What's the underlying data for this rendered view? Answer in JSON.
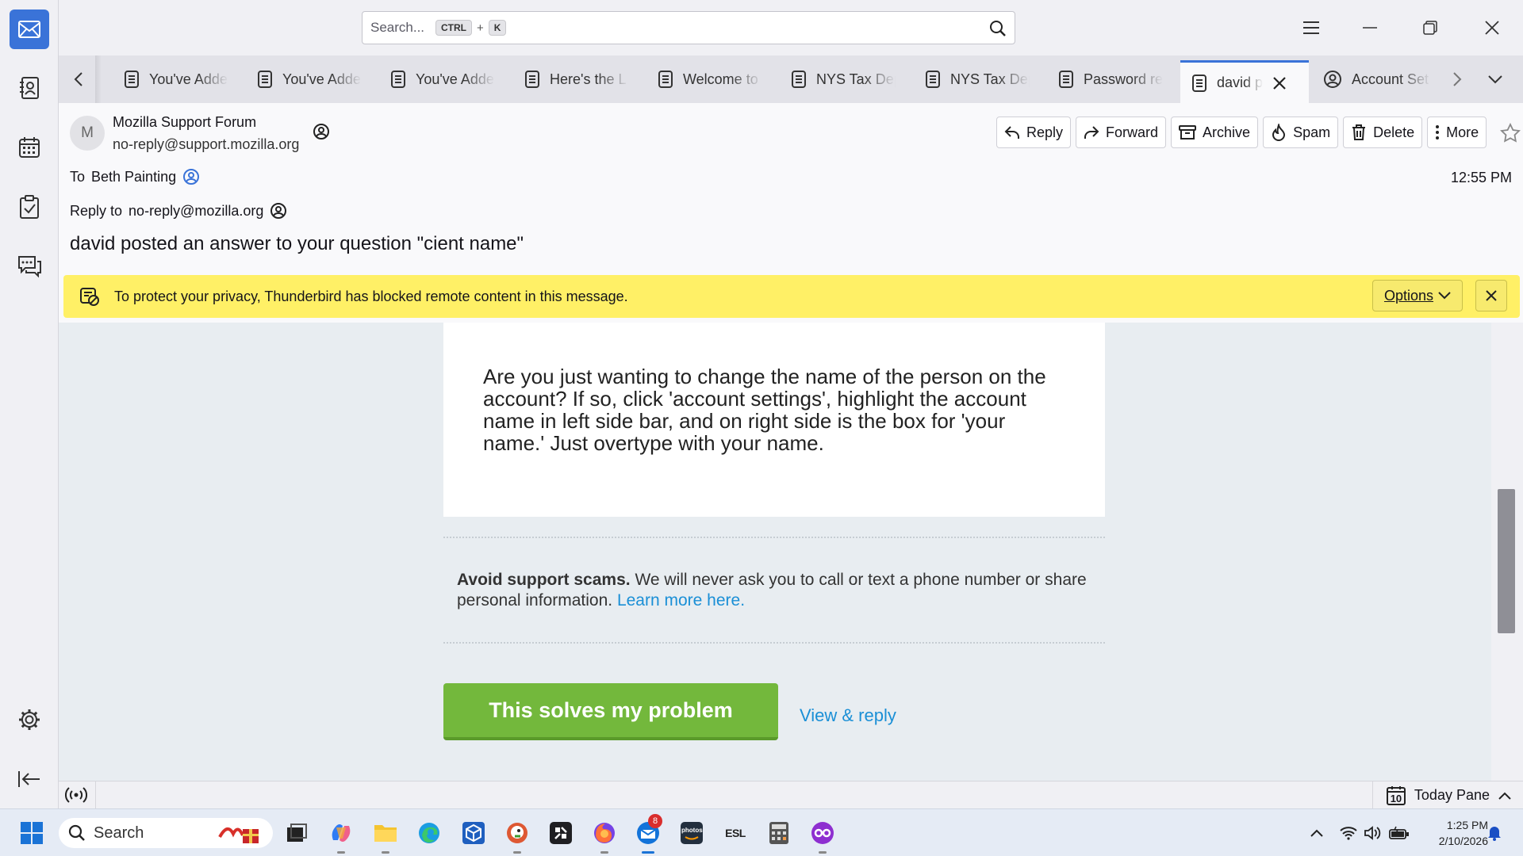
{
  "search": {
    "placeholder": "Search...",
    "key1": "CTRL",
    "plus": "+",
    "key2": "K"
  },
  "tabs": [
    {
      "label": "You've Added"
    },
    {
      "label": "You've Added"
    },
    {
      "label": "You've Added"
    },
    {
      "label": "Here's the L"
    },
    {
      "label": "Welcome to"
    },
    {
      "label": "NYS Tax Dep"
    },
    {
      "label": "NYS Tax Dep"
    },
    {
      "label": "Password re"
    },
    {
      "label": "david po",
      "active": true
    },
    {
      "label": "Account Set"
    }
  ],
  "message": {
    "avatar_letter": "M",
    "from_name": "Mozilla Support Forum",
    "from_address": "no-reply@support.mozilla.org",
    "to_label": "To",
    "to_name": "Beth Painting",
    "time": "12:55 PM",
    "reply_to_label": "Reply to",
    "reply_to": "no-reply@mozilla.org",
    "subject": "david posted an answer to your question \"cient name\""
  },
  "header_buttons": {
    "reply": "Reply",
    "forward": "Forward",
    "archive": "Archive",
    "spam": "Spam",
    "delete": "Delete",
    "more": "More"
  },
  "banner": {
    "text": "To protect your privacy, Thunderbird has blocked remote content in this message.",
    "options": "Options",
    "color": "#fff066"
  },
  "body": {
    "answer": "Are you just wanting to change the name of the person on the account? If so, click 'account settings', highlight the account name in left side bar, and on right side is the box for 'your name.' Just overtype with your name.",
    "scam_bold": "Avoid support scams.",
    "scam_text": " We will never ask you to call or text a phone number or share personal information. ",
    "scam_link": "Learn more here.",
    "solve_button": "This solves my problem",
    "view_reply": "View & reply",
    "accent_green": "#73b83c",
    "link_color": "#1a8fd6"
  },
  "statusbar": {
    "today_pane": "Today Pane",
    "calendar_day": "10"
  },
  "taskbar": {
    "search": "Search",
    "mail_badge": "8",
    "photos_label": "photos",
    "esl_label": "ESL",
    "clock_time": "1:25 PM",
    "clock_date": "2/10/2026"
  }
}
